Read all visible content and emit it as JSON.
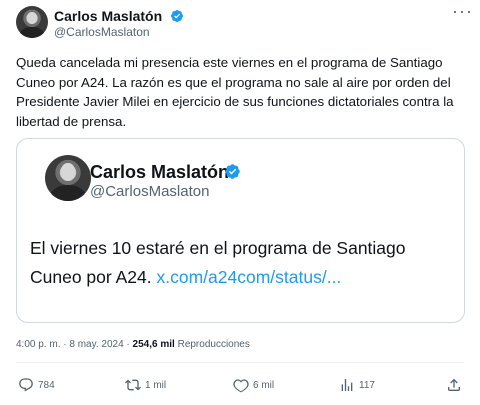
{
  "author": {
    "name": "Carlos Maslatón",
    "handle": "@CarlosMaslaton"
  },
  "tweet": {
    "text": "Queda cancelada mi presencia este viernes en el programa de Santiago Cuneo por A24. La razón es que el programa no sale al aire por orden del Presidente Javier Milei en ejercicio de sus funciones dictatoriales contra la libertad de prensa."
  },
  "quote": {
    "name": "Carlos Maslatón",
    "handle": "@CarlosMaslaton",
    "text": "El viernes 10 estaré en el programa de Santiago Cuneo por A24.",
    "link": "x.com/a24com/status/..."
  },
  "meta": {
    "time": "4:00 p. m.",
    "separator1": " · ",
    "date": "8 may. 2024",
    "separator2": " · ",
    "views_count": "254,6 mil",
    "views_label": " Reproducciones"
  },
  "actions": {
    "reply_count": "784",
    "repost_count": "1 mil",
    "like_count": "6 mil",
    "views_count": "117"
  },
  "icons": {
    "more": "more-horizontal-icon",
    "verified": "verified-badge-icon",
    "reply": "reply-icon",
    "repost": "repost-icon",
    "like": "heart-icon",
    "views": "views-icon",
    "share": "share-icon"
  },
  "colors": {
    "accent": "#1d9bf0",
    "text": "#0f1419",
    "secondary": "#536471",
    "border": "#cfd9de"
  }
}
